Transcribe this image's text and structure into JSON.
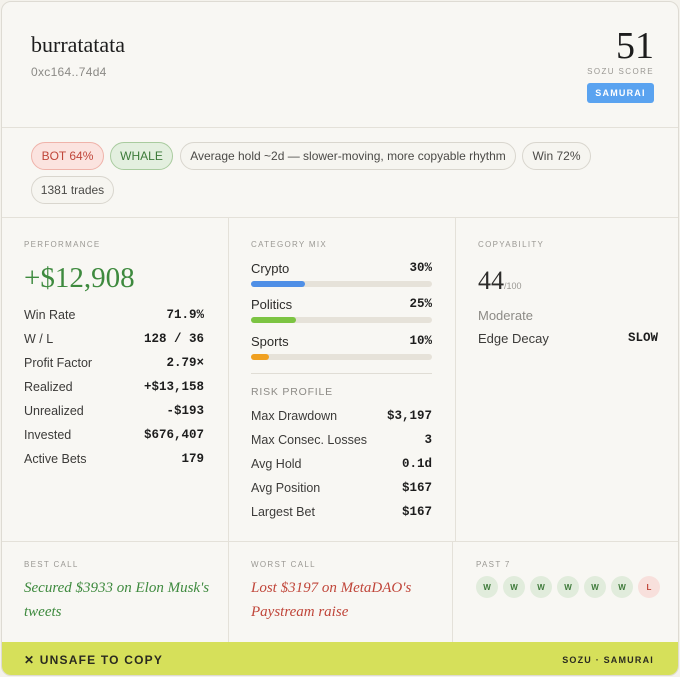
{
  "header": {
    "username": "burratatata",
    "address": "0xc164..74d4",
    "score": "51",
    "score_label": "SOZU SCORE",
    "tier": "SAMURAI"
  },
  "tags": {
    "bot": "BOT 64%",
    "whale": "WHALE",
    "hold": "Average hold ~2d — slower-moving, more copyable rhythm",
    "win": "Win 72%",
    "trades": "1381 trades"
  },
  "performance": {
    "label": "PERFORMANCE",
    "pnl": "+$12,908",
    "rows": [
      {
        "k": "Win Rate",
        "v": "71.9%"
      },
      {
        "k": "W / L",
        "v": "128 / 36"
      },
      {
        "k": "Profit Factor",
        "v": "2.79×"
      },
      {
        "k": "Realized",
        "v": "+$13,158"
      },
      {
        "k": "Unrealized",
        "v": "-$193"
      },
      {
        "k": "Invested",
        "v": "$676,407"
      },
      {
        "k": "Active Bets",
        "v": "179"
      }
    ]
  },
  "category": {
    "label": "CATEGORY MIX",
    "items": [
      {
        "name": "Crypto",
        "pct": "30%",
        "value": 0.3,
        "color": "#4f8fe6"
      },
      {
        "name": "Politics",
        "pct": "25%",
        "value": 0.25,
        "color": "#7cc442"
      },
      {
        "name": "Sports",
        "pct": "10%",
        "value": 0.1,
        "color": "#f0a020"
      }
    ]
  },
  "risk": {
    "label": "RISK PROFILE",
    "rows": [
      {
        "k": "Max Drawdown",
        "v": "$3,197"
      },
      {
        "k": "Max Consec. Losses",
        "v": "3"
      },
      {
        "k": "Avg Hold",
        "v": "0.1d"
      },
      {
        "k": "Avg Position",
        "v": "$167"
      },
      {
        "k": "Largest Bet",
        "v": "$167"
      }
    ]
  },
  "copyability": {
    "label": "COPYABILITY",
    "score": "44",
    "max": "/100",
    "level": "Moderate",
    "decay_label": "Edge Decay",
    "decay_value": "SLOW"
  },
  "best_call": {
    "label": "BEST CALL",
    "text": "Secured $3933 on Elon Musk's tweets"
  },
  "worst_call": {
    "label": "WORST CALL",
    "text": "Lost $3197 on MetaDAO's Paystream raise"
  },
  "past": {
    "label": "PAST 7",
    "results": [
      "W",
      "W",
      "W",
      "W",
      "W",
      "W",
      "L"
    ]
  },
  "footer": {
    "verdict": "✕ UNSAFE TO COPY",
    "brand": "SOZU · SAMURAI"
  }
}
